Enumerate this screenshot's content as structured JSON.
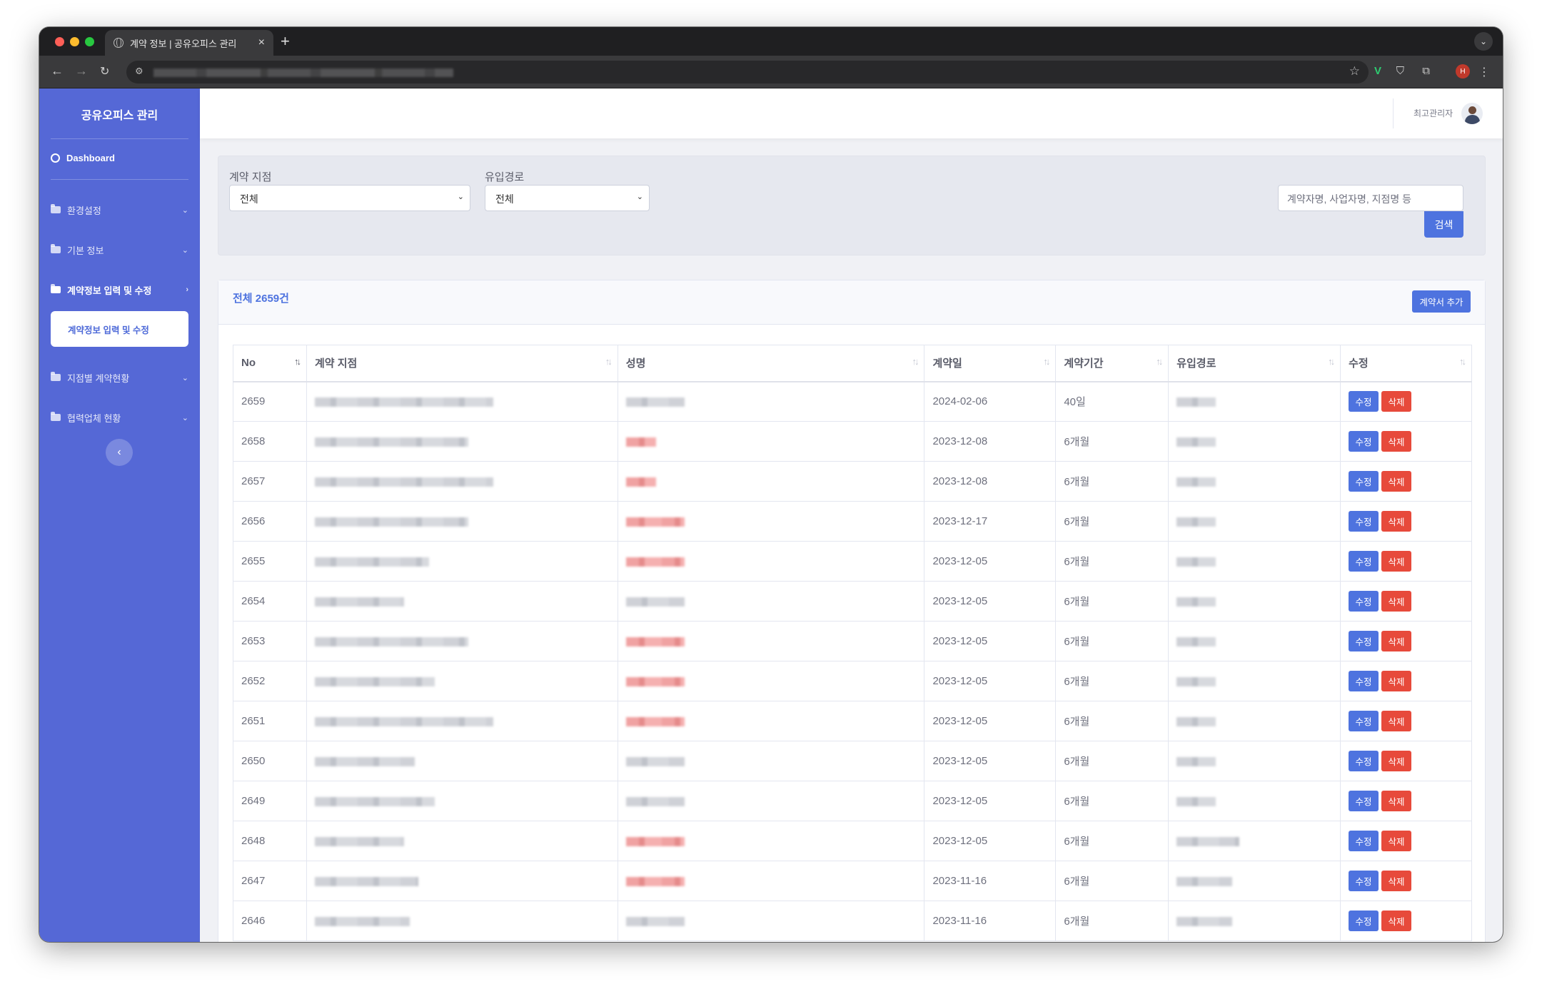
{
  "browser": {
    "tab_title": "계약 정보 | 공유오피스 관리",
    "new_tab": "+",
    "profile_initial": "H"
  },
  "sidebar": {
    "brand": "공유오피스 관리",
    "dashboard": "Dashboard",
    "items": [
      {
        "label": "환경설정",
        "chevron": "⌄"
      },
      {
        "label": "기본 정보",
        "chevron": "⌄"
      },
      {
        "label": "계약정보 입력 및 수정",
        "chevron": "›"
      },
      {
        "label": "지점별 계약현황",
        "chevron": "⌄"
      },
      {
        "label": "협력업체 현황",
        "chevron": "⌄"
      }
    ],
    "sub_item": "계약정보 입력 및 수정",
    "collapse": "‹"
  },
  "topbar": {
    "user": "최고관리자"
  },
  "filter": {
    "branch_label": "계약 지점",
    "branch_value": "전체",
    "channel_label": "유입경로",
    "channel_value": "전체",
    "search_placeholder": "계약자명, 사업자명, 지점명 등",
    "search_button": "검색"
  },
  "card": {
    "total": "전체 2659건",
    "add_button": "계약서 추가"
  },
  "table": {
    "headers": [
      "No",
      "계약 지점",
      "성명",
      "계약일",
      "계약기간",
      "유입경로",
      "수정"
    ],
    "edit_label": "수정",
    "delete_label": "삭제",
    "rows": [
      {
        "no": "2659",
        "date": "2024-02-06",
        "period": "40일"
      },
      {
        "no": "2658",
        "date": "2023-12-08",
        "period": "6개월"
      },
      {
        "no": "2657",
        "date": "2023-12-08",
        "period": "6개월"
      },
      {
        "no": "2656",
        "date": "2023-12-17",
        "period": "6개월"
      },
      {
        "no": "2655",
        "date": "2023-12-05",
        "period": "6개월"
      },
      {
        "no": "2654",
        "date": "2023-12-05",
        "period": "6개월"
      },
      {
        "no": "2653",
        "date": "2023-12-05",
        "period": "6개월"
      },
      {
        "no": "2652",
        "date": "2023-12-05",
        "period": "6개월"
      },
      {
        "no": "2651",
        "date": "2023-12-05",
        "period": "6개월"
      },
      {
        "no": "2650",
        "date": "2023-12-05",
        "period": "6개월"
      },
      {
        "no": "2649",
        "date": "2023-12-05",
        "period": "6개월"
      },
      {
        "no": "2648",
        "date": "2023-12-05",
        "period": "6개월"
      },
      {
        "no": "2647",
        "date": "2023-11-16",
        "period": "6개월"
      },
      {
        "no": "2646",
        "date": "2023-11-16",
        "period": "6개월"
      }
    ]
  }
}
